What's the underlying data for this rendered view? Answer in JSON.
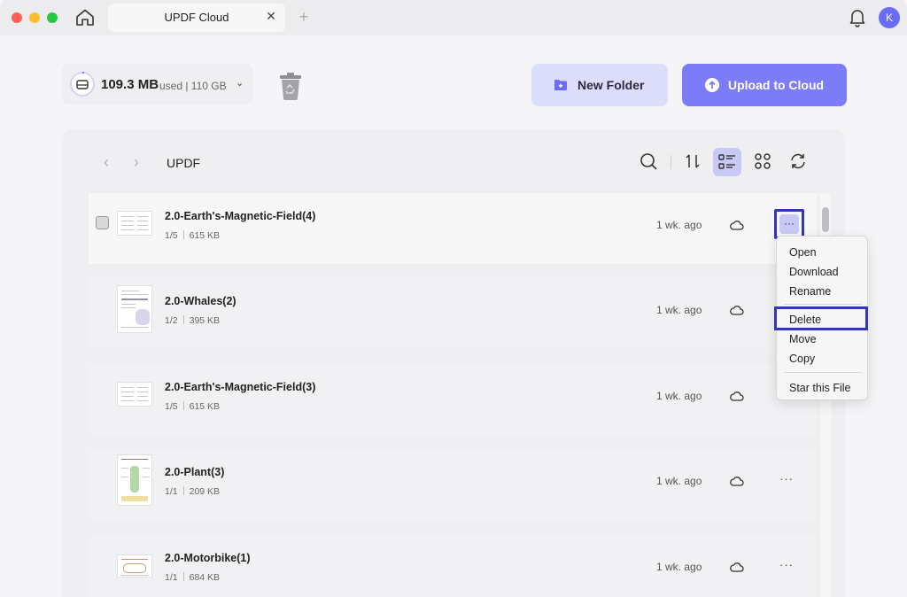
{
  "titlebar": {
    "tab_title": "UPDF Cloud",
    "tab_close": "✕",
    "tab_add": "+",
    "avatar_initial": "K"
  },
  "storage": {
    "used": "109.3 MB",
    "detail": "used | 110 GB"
  },
  "actions": {
    "new_folder": "New Folder",
    "upload": "Upload to Cloud"
  },
  "browser": {
    "breadcrumb": "UPDF"
  },
  "files": [
    {
      "name": "2.0-Earth's-Magnetic-Field(4)",
      "pages": "1/5",
      "size": "615 KB",
      "time": "1 wk. ago"
    },
    {
      "name": "2.0-Whales(2)",
      "pages": "1/2",
      "size": "395 KB",
      "time": "1 wk. ago"
    },
    {
      "name": "2.0-Earth's-Magnetic-Field(3)",
      "pages": "1/5",
      "size": "615 KB",
      "time": "1 wk. ago"
    },
    {
      "name": "2.0-Plant(3)",
      "pages": "1/1",
      "size": "209 KB",
      "time": "1 wk. ago"
    },
    {
      "name": "2.0-Motorbike(1)",
      "pages": "1/1",
      "size": "684 KB",
      "time": "1 wk. ago"
    }
  ],
  "context_menu": {
    "open": "Open",
    "download": "Download",
    "rename": "Rename",
    "delete": "Delete",
    "move": "Move",
    "copy": "Copy",
    "star": "Star this File"
  },
  "colors": {
    "accent": "#7b7cf6",
    "accent_light": "#dcdcfb",
    "highlight_border": "#3137b5"
  }
}
